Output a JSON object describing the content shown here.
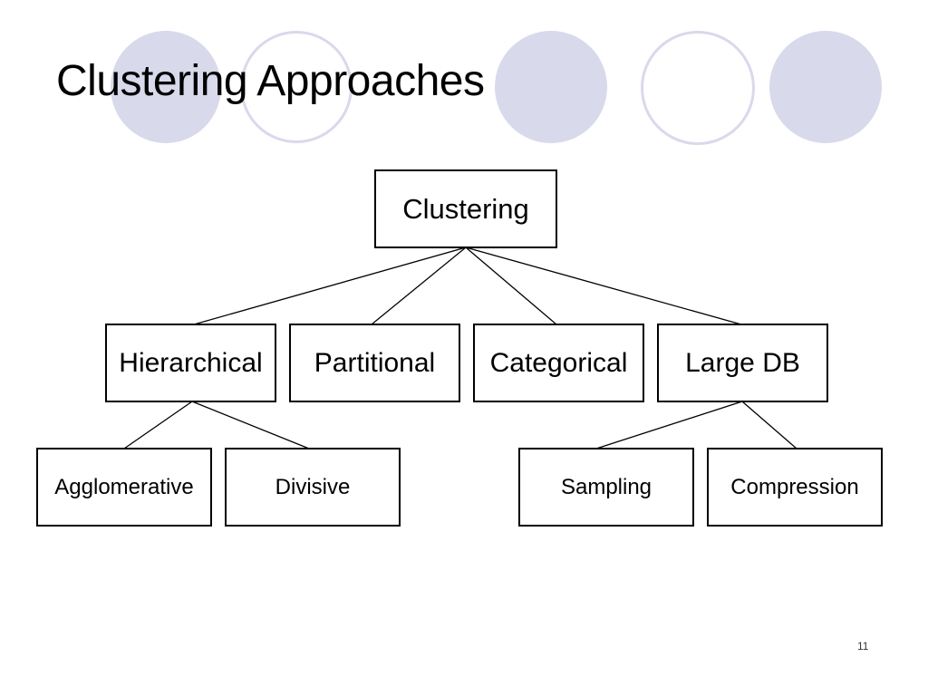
{
  "slide": {
    "title": "Clustering Approaches",
    "page_number": "11",
    "decoration_color": "#d9d9ec"
  },
  "tree": {
    "root": {
      "label": "Clustering"
    },
    "level2": [
      {
        "id": "hierarchical",
        "label": "Hierarchical"
      },
      {
        "id": "partitional",
        "label": "Partitional"
      },
      {
        "id": "categorical",
        "label": "Categorical"
      },
      {
        "id": "large-db",
        "label": "Large DB"
      }
    ],
    "level3": [
      {
        "id": "agglomerative",
        "label": "Agglomerative",
        "parent": "hierarchical"
      },
      {
        "id": "divisive",
        "label": "Divisive",
        "parent": "hierarchical"
      },
      {
        "id": "sampling",
        "label": "Sampling",
        "parent": "large-db"
      },
      {
        "id": "compression",
        "label": "Compression",
        "parent": "large-db"
      }
    ]
  }
}
